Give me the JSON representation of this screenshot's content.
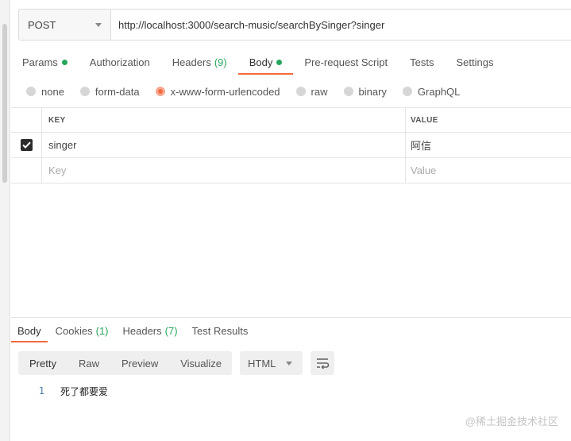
{
  "request": {
    "method": "POST",
    "url": "http://localhost:3000/search-music/searchBySinger?singer"
  },
  "tabs": [
    {
      "label": "Params",
      "count": "",
      "dot": true
    },
    {
      "label": "Authorization",
      "count": "",
      "dot": false
    },
    {
      "label": "Headers",
      "count": "(9)",
      "dot": false
    },
    {
      "label": "Body",
      "count": "",
      "dot": true,
      "active": true
    },
    {
      "label": "Pre-request Script",
      "count": "",
      "dot": false
    },
    {
      "label": "Tests",
      "count": "",
      "dot": false
    },
    {
      "label": "Settings",
      "count": "",
      "dot": false
    }
  ],
  "body_types": [
    {
      "label": "none",
      "selected": false
    },
    {
      "label": "form-data",
      "selected": false
    },
    {
      "label": "x-www-form-urlencoded",
      "selected": true
    },
    {
      "label": "raw",
      "selected": false
    },
    {
      "label": "binary",
      "selected": false
    },
    {
      "label": "GraphQL",
      "selected": false
    }
  ],
  "params_table": {
    "headers": {
      "key": "KEY",
      "value": "VALUE"
    },
    "rows": [
      {
        "checked": true,
        "key": "singer",
        "value": "阿信"
      }
    ],
    "placeholder": {
      "key": "Key",
      "value": "Value"
    }
  },
  "response": {
    "tabs": [
      {
        "label": "Body",
        "count": "",
        "active": true
      },
      {
        "label": "Cookies",
        "count": "(1)"
      },
      {
        "label": "Headers",
        "count": "(7)"
      },
      {
        "label": "Test Results",
        "count": ""
      }
    ],
    "view_modes": [
      "Pretty",
      "Raw",
      "Preview",
      "Visualize"
    ],
    "active_view": "Pretty",
    "format": "HTML",
    "lines": [
      {
        "num": "1",
        "text": "死了都要爱"
      }
    ]
  },
  "icons": {
    "method_dropdown": "chevron-down-icon",
    "checkbox": "check-icon",
    "wrap": "wrap-lines-icon"
  },
  "colors": {
    "accent": "#f26b3a",
    "status_green": "#26a65b"
  },
  "watermark": "@稀土掘金技术社区"
}
